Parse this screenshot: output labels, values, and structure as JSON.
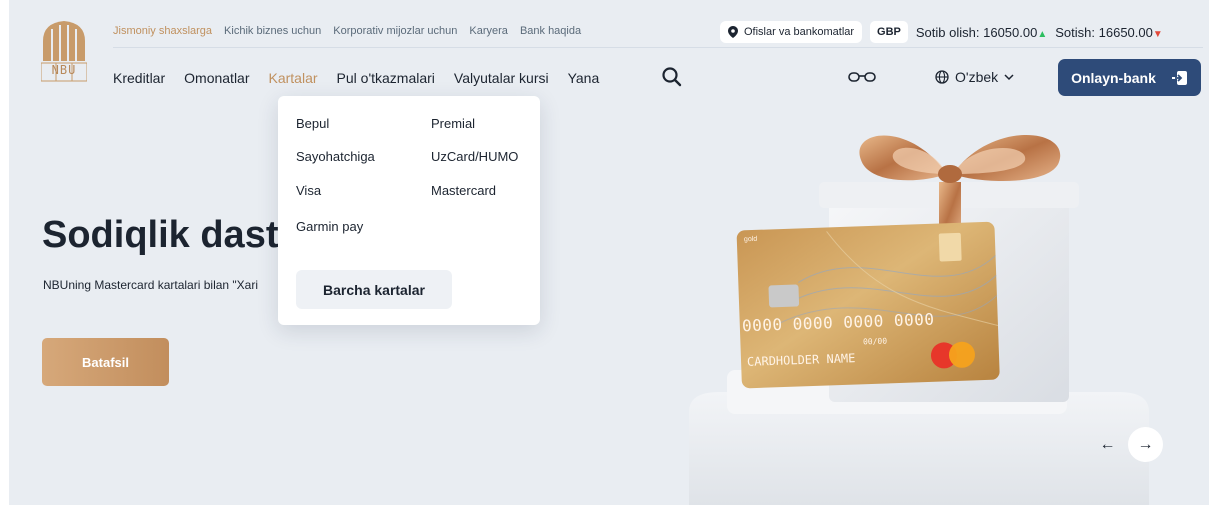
{
  "logo": {
    "text": "NBU",
    "icon": "nbu-logo-icon"
  },
  "top_nav": {
    "items": [
      {
        "label": "Jismoniy shaxslarga",
        "active": true
      },
      {
        "label": "Kichik biznes uchun",
        "active": false
      },
      {
        "label": "Korporativ mijozlar uchun",
        "active": false
      },
      {
        "label": "Karyera",
        "active": false
      },
      {
        "label": "Bank haqida",
        "active": false
      }
    ]
  },
  "top_right": {
    "offices_label": "Ofislar va bankomatlar",
    "currency": "GBP",
    "buy_label": "Sotib olish:",
    "buy_value": "16050.00",
    "sell_label": "Sotish:",
    "sell_value": "16650.00"
  },
  "main_nav": {
    "items": [
      {
        "label": "Kreditlar",
        "active": false
      },
      {
        "label": "Omonatlar",
        "active": false
      },
      {
        "label": "Kartalar",
        "active": true
      },
      {
        "label": "Pul o'tkazmalari",
        "active": false
      },
      {
        "label": "Valyutalar kursi",
        "active": false
      },
      {
        "label": "Yana",
        "active": false
      }
    ],
    "language": "O'zbek",
    "online_bank_label": "Onlayn-bank"
  },
  "dropdown": {
    "left_items": [
      "Bepul",
      "Sayohatchiga",
      "Visa",
      "Garmin pay"
    ],
    "right_items": [
      "Premial",
      "UzCard/HUMO",
      "Mastercard"
    ],
    "all_cards_label": "Barcha kartalar"
  },
  "hero": {
    "title": "Sodiqlik dast",
    "subtitle": "NBUning Mastercard kartalari bilan \"Xari",
    "cta_label": "Batafsil",
    "card": {
      "brand_text": "gold",
      "number": "0000 0000 0000 0000",
      "expiry": "00/00",
      "holder": "CARDHOLDER NAME"
    },
    "prev_arrow": "←",
    "next_arrow": "→"
  },
  "colors": {
    "accent_gold": "#c0915f",
    "primary_blue": "#2e4b79",
    "background": "#e9edf2",
    "rate_up": "#2dbe60",
    "rate_down": "#e2493a"
  }
}
